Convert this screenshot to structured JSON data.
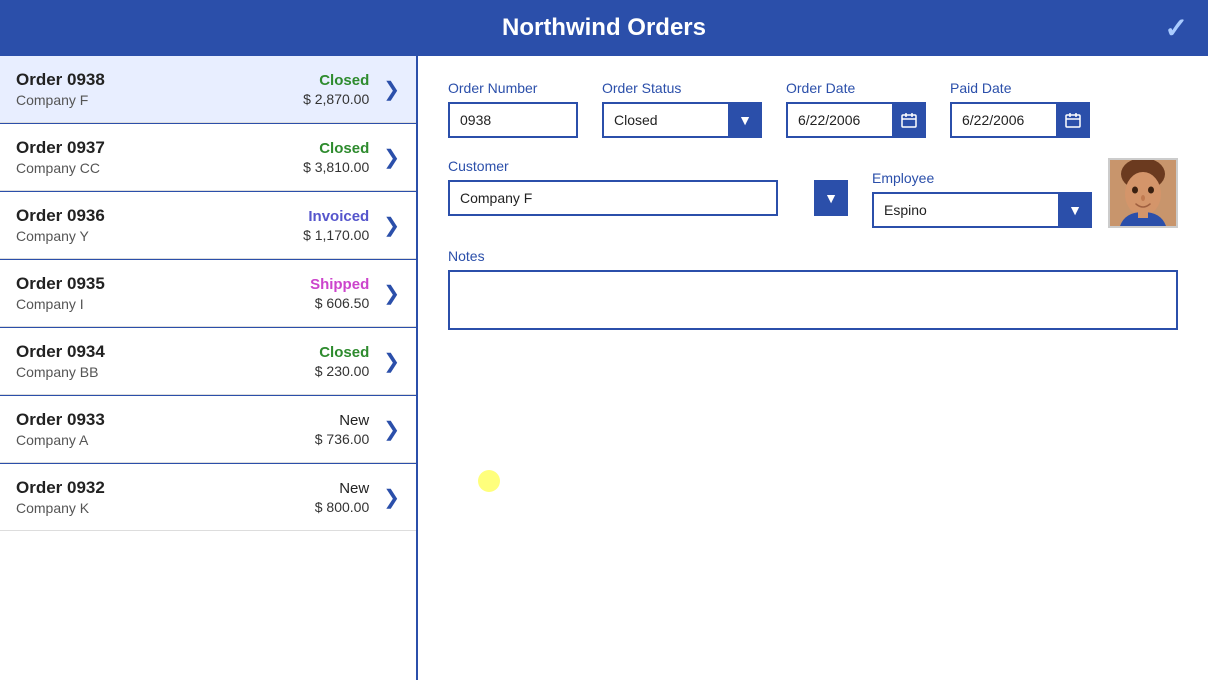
{
  "header": {
    "title": "Northwind Orders",
    "check_icon": "✓"
  },
  "orders": [
    {
      "id": "order-0938",
      "name": "Order 0938",
      "company": "Company F",
      "status": "Closed",
      "status_class": "status-closed",
      "amount": "$ 2,870.00",
      "active": true
    },
    {
      "id": "order-0937",
      "name": "Order 0937",
      "company": "Company CC",
      "status": "Closed",
      "status_class": "status-closed",
      "amount": "$ 3,810.00",
      "active": false
    },
    {
      "id": "order-0936",
      "name": "Order 0936",
      "company": "Company Y",
      "status": "Invoiced",
      "status_class": "status-invoiced",
      "amount": "$ 1,170.00",
      "active": false
    },
    {
      "id": "order-0935",
      "name": "Order 0935",
      "company": "Company I",
      "status": "Shipped",
      "status_class": "status-shipped",
      "amount": "$ 606.50",
      "active": false
    },
    {
      "id": "order-0934",
      "name": "Order 0934",
      "company": "Company BB",
      "status": "Closed",
      "status_class": "status-closed",
      "amount": "$ 230.00",
      "active": false
    },
    {
      "id": "order-0933",
      "name": "Order 0933",
      "company": "Company A",
      "status": "New",
      "status_class": "status-new",
      "amount": "$ 736.00",
      "active": false
    },
    {
      "id": "order-0932",
      "name": "Order 0932",
      "company": "Company K",
      "status": "New",
      "status_class": "status-new",
      "amount": "$ 800.00",
      "active": false
    }
  ],
  "detail": {
    "order_number_label": "Order Number",
    "order_number_value": "0938",
    "order_status_label": "Order Status",
    "order_status_value": "Closed",
    "order_date_label": "Order Date",
    "order_date_value": "6/22/2006",
    "paid_date_label": "Paid Date",
    "paid_date_value": "6/22/2006",
    "customer_label": "Customer",
    "customer_value": "Company F",
    "employee_label": "Employee",
    "employee_value": "Espino",
    "notes_label": "Notes",
    "notes_value": "",
    "notes_placeholder": "",
    "status_options": [
      "New",
      "Shipped",
      "Invoiced",
      "Closed"
    ],
    "customer_options": [
      "Company A",
      "Company BB",
      "Company CC",
      "Company F",
      "Company I",
      "Company K",
      "Company Y"
    ],
    "employee_options": [
      "Espino"
    ]
  },
  "icons": {
    "chevron": "❯",
    "calendar": "📅",
    "dropdown_arrow": "▼",
    "checkmark": "✓"
  }
}
